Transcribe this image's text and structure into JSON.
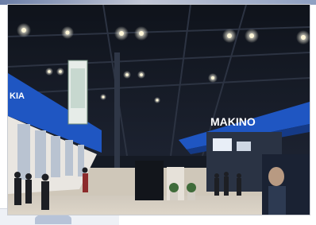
{
  "scene": {
    "booth_sign_primary": "MAKINO",
    "booth_sign_left_partial": "KIA"
  },
  "colors": {
    "ceiling": "#141821",
    "floor": "#cfc7b9",
    "booth_blue": "#1f56c2",
    "booth_blue_dark": "#153a86",
    "light": "#fff7d8"
  }
}
